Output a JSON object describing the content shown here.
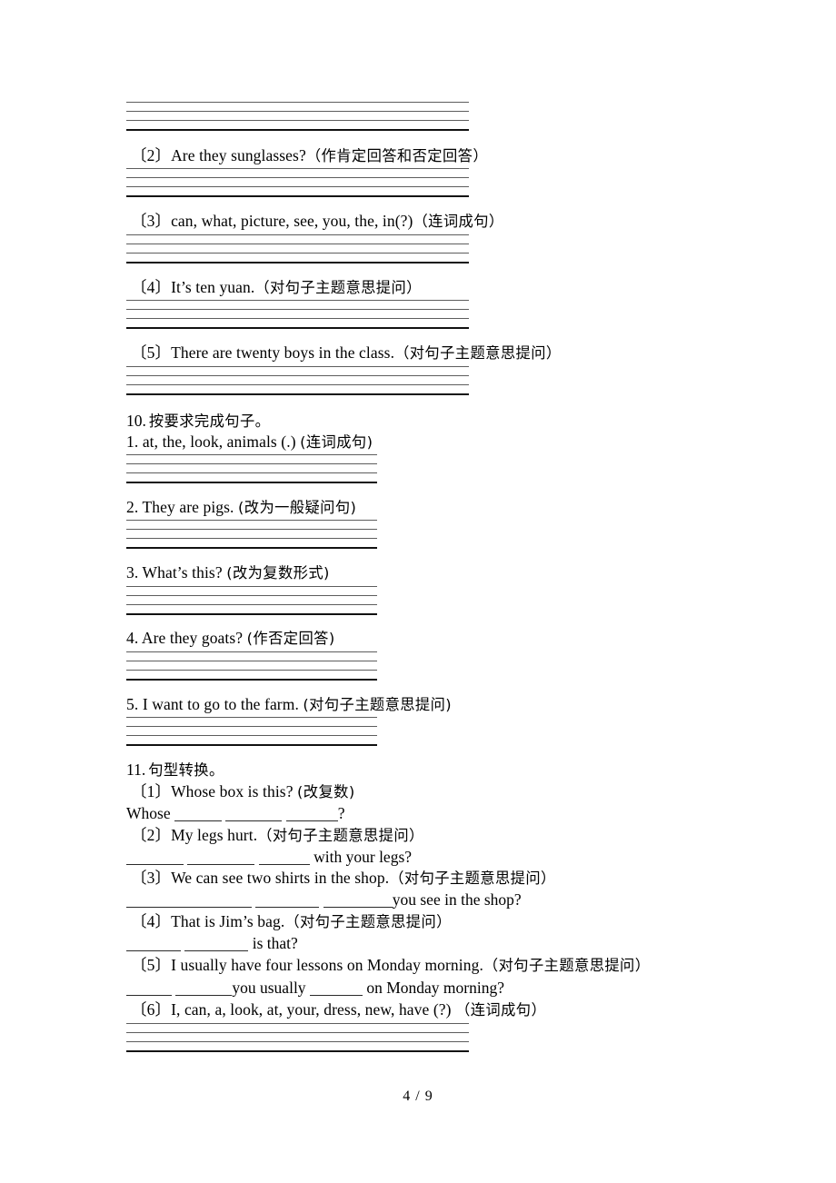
{
  "document": {
    "page_footer": "4 / 9"
  },
  "section9_tail": {
    "items": [
      {
        "label": "〔2〕",
        "text": "Are they sunglasses?",
        "instruction": "（作肯定回答和否定回答）"
      },
      {
        "label": "〔3〕",
        "text": "can, what, picture, see, you, the, in(?)",
        "instruction": "（连词成句）"
      },
      {
        "label": "〔4〕",
        "text": "It’s ten yuan.",
        "instruction": "（对句子主题意思提问）"
      },
      {
        "label": "〔5〕",
        "text": "There are twenty boys in the class.",
        "instruction": "（对句子主题意思提问）"
      }
    ]
  },
  "section10": {
    "number": "10.",
    "title": "按要求完成句子。",
    "items": [
      {
        "label": "1.",
        "text": "at, the, look, animals (.)",
        "instruction": "(连词成句)"
      },
      {
        "label": "2.",
        "text": "They are pigs.",
        "instruction": "(改为一般疑问句)"
      },
      {
        "label": "3.",
        "text": "What’s this?",
        "instruction": "(改为复数形式)"
      },
      {
        "label": "4.",
        "text": "Are they goats?",
        "instruction": "(作否定回答)"
      },
      {
        "label": "5.",
        "text": "I want to go to the farm.",
        "instruction": "(对句子主题意思提问)"
      }
    ]
  },
  "section11": {
    "number": "11.",
    "title": "句型转换。",
    "items": [
      {
        "label": "〔1〕",
        "text": "Whose box is this?",
        "instruction": "(改复数)",
        "answer_prefix": "Whose",
        "answer_suffix": "?"
      },
      {
        "label": "〔2〕",
        "text": "My legs hurt.",
        "instruction": "（对句子主题意思提问）",
        "answer_prefix": "",
        "answer_suffix": "with your legs?"
      },
      {
        "label": "〔3〕",
        "text": "We can see two shirts in the shop.",
        "instruction": "（对句子主题意思提问）",
        "answer_prefix": "",
        "answer_suffix": "you see in the shop?"
      },
      {
        "label": "〔4〕",
        "text": "That is Jim’s bag.",
        "instruction": "（对句子主题意思提问）",
        "answer_prefix": "",
        "answer_suffix": "is that?"
      },
      {
        "label": "〔5〕",
        "text": "I usually have four lessons on Monday morning.",
        "instruction": "（对句子主题意思提问）",
        "answer_prefix": "",
        "answer_middle": "you usually",
        "answer_suffix": "on Monday morning?"
      },
      {
        "label": "〔6〕",
        "text": "I, can, a, look, at, your, dress, new, have (?)",
        "instruction": "（连词成句）"
      }
    ]
  }
}
